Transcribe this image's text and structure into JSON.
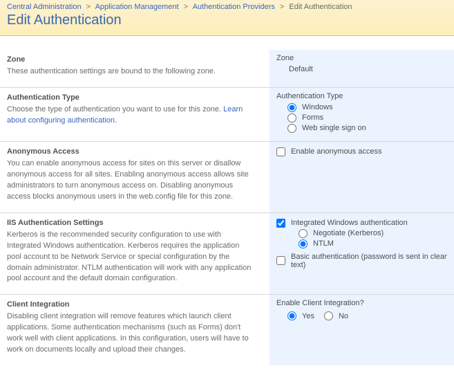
{
  "breadcrumb": {
    "items": [
      {
        "label": "Central Administration"
      },
      {
        "label": "Application Management"
      },
      {
        "label": "Authentication Providers"
      }
    ],
    "current": "Edit Authentication"
  },
  "page_title": "Edit Authentication",
  "sections": {
    "zone": {
      "title": "Zone",
      "desc": "These authentication settings are bound to the following zone.",
      "field_label": "Zone",
      "value": "Default"
    },
    "auth_type": {
      "title": "Authentication Type",
      "desc_prefix": "Choose the type of authentication you want to use for this zone. ",
      "link": "Learn about configuring authentication.",
      "field_label": "Authentication Type",
      "options": {
        "windows": "Windows",
        "forms": "Forms",
        "wsso": "Web single sign on"
      },
      "selected": "windows"
    },
    "anon": {
      "title": "Anonymous Access",
      "desc": "You can enable anonymous access for sites on this server or disallow anonymous access for all sites. Enabling anonymous access allows site administrators to turn anonymous access on. Disabling anonymous access blocks anonymous users in the web.config file for this zone.",
      "checkbox_label": "Enable anonymous access",
      "checked": false
    },
    "iis": {
      "title": "IIS Authentication Settings",
      "desc": "Kerberos is the recommended security configuration to use with Integrated Windows authentication.  Kerberos requires the application pool account to be Network Service or special configuration by the domain administrator.  NTLM authentication will work with any application pool account and the default domain configuration.",
      "iwa_label": "Integrated Windows authentication",
      "iwa_checked": true,
      "sub_options": {
        "negotiate": "Negotiate (Kerberos)",
        "ntlm": "NTLM"
      },
      "sub_selected": "ntlm",
      "basic_label": "Basic authentication (password is sent in clear text)",
      "basic_checked": false
    },
    "client": {
      "title": "Client Integration",
      "desc": "Disabling client integration will remove features which launch client applications. Some authentication mechanisms (such as Forms) don't work well with client applications. In this configuration, users will have to work on documents locally and upload their changes.",
      "field_label": "Enable Client Integration?",
      "options": {
        "yes": "Yes",
        "no": "No"
      },
      "selected": "yes"
    }
  }
}
